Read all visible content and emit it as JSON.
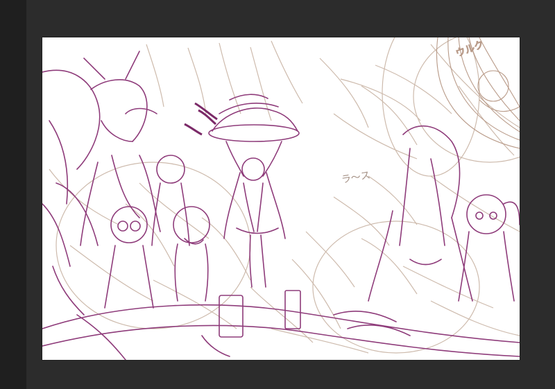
{
  "app": {
    "panel": "sidebar",
    "workspace": "canvas"
  },
  "artwork": {
    "katakana_left": "ラ〜ス",
    "katakana_top_right": "ウルク",
    "colors": {
      "ink_purple": "#8e3b7a",
      "ink_beige": "#c9b2a2",
      "paper": "#ffffff",
      "workspace": "#2c2c2c"
    }
  }
}
